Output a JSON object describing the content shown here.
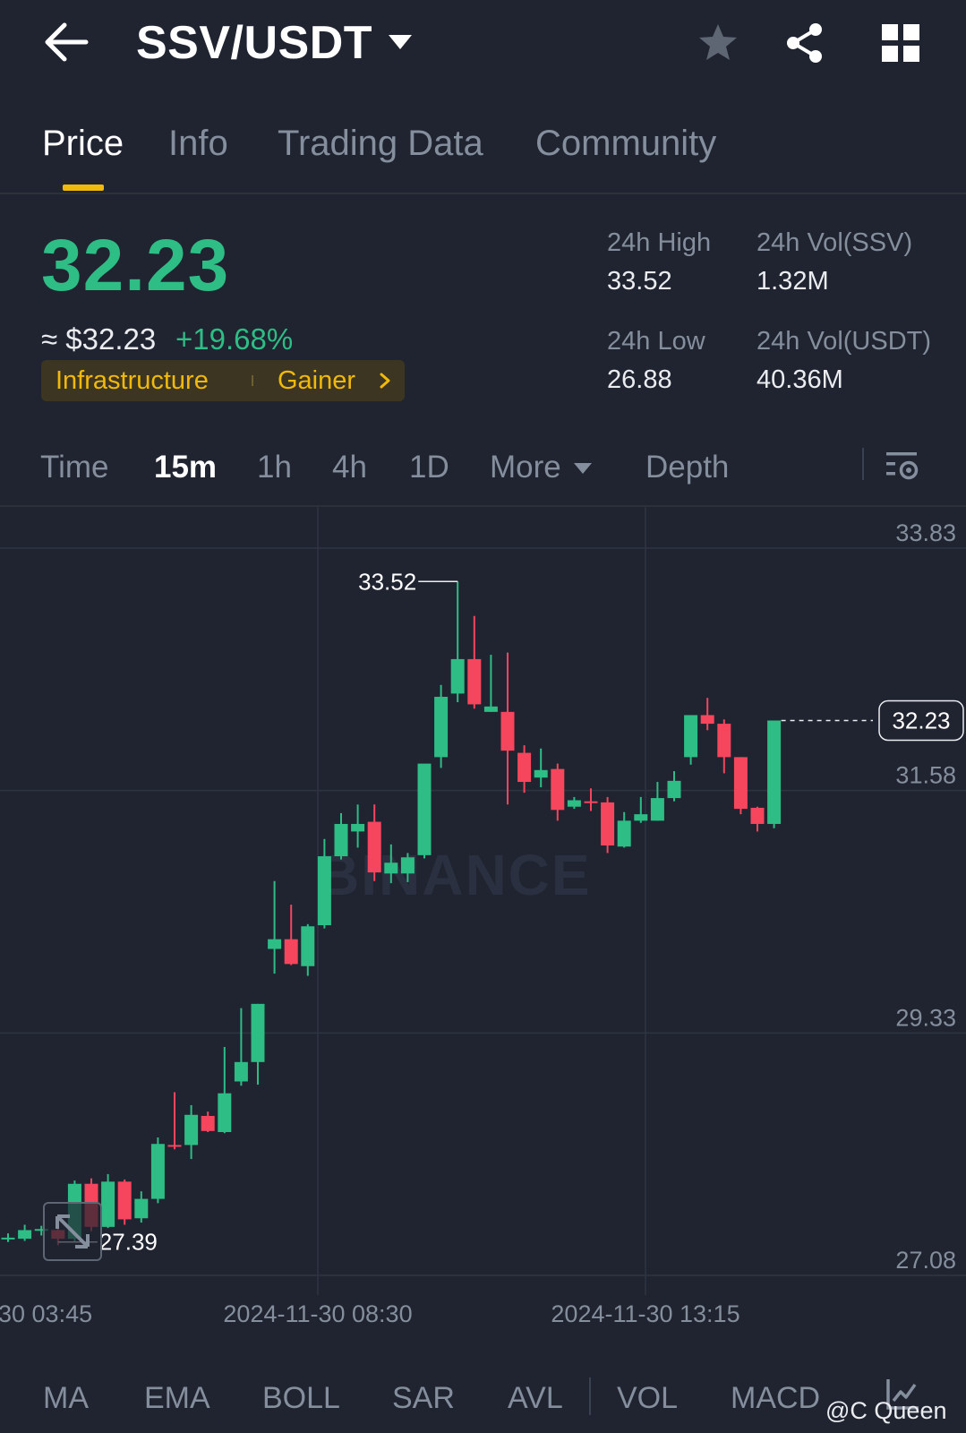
{
  "header": {
    "pair": "SSV/USDT",
    "icons": [
      "back-arrow-icon",
      "caret-down-icon",
      "star-icon",
      "share-icon",
      "grid-icon"
    ]
  },
  "tabs": [
    {
      "label": "Price",
      "active": true
    },
    {
      "label": "Info",
      "active": false
    },
    {
      "label": "Trading Data",
      "active": false
    },
    {
      "label": "Community",
      "active": false
    }
  ],
  "price": {
    "last": "32.23",
    "usd": "≈ $32.23",
    "change": "+19.68%",
    "tag_category": "Infrastructure",
    "tag_rank": "Gainer"
  },
  "stats": {
    "high_label": "24h High",
    "high_value": "33.52",
    "low_label": "24h Low",
    "low_value": "26.88",
    "vol_base_label": "24h Vol(SSV)",
    "vol_base_value": "1.32M",
    "vol_quote_label": "24h Vol(USDT)",
    "vol_quote_value": "40.36M"
  },
  "intervals": [
    {
      "label": "Time",
      "active": false
    },
    {
      "label": "15m",
      "active": true
    },
    {
      "label": "1h",
      "active": false
    },
    {
      "label": "4h",
      "active": false
    },
    {
      "label": "1D",
      "active": false
    },
    {
      "label": "More",
      "active": false
    },
    {
      "label": "Depth",
      "active": false
    }
  ],
  "colors": {
    "up": "#2ebd85",
    "down": "#f6465d",
    "accent": "#f0b90b",
    "background": "#1f2430"
  },
  "chart": {
    "watermark": "BINANCE",
    "price_axis": [
      "33.83",
      "31.58",
      "29.33",
      "27.08"
    ],
    "time_axis": [
      "30 03:45",
      "2024-11-30 08:30",
      "2024-11-30 13:15"
    ],
    "high_marker": "33.52",
    "low_marker": "27.39",
    "last_price_label": "32.23"
  },
  "chart_data": {
    "type": "candlestick",
    "interval": "15m",
    "y_ticks": [
      33.83,
      31.58,
      29.33,
      27.08
    ],
    "x_ticks": [
      "30 03:45",
      "2024-11-30 08:30",
      "2024-11-30 13:15"
    ],
    "ylim": [
      27.08,
      33.83
    ],
    "high": 33.52,
    "low": 27.39,
    "last": 32.23,
    "candles": [
      {
        "o": 27.43,
        "h": 27.47,
        "l": 27.39,
        "c": 27.43
      },
      {
        "o": 27.42,
        "h": 27.55,
        "l": 27.4,
        "c": 27.5
      },
      {
        "o": 27.5,
        "h": 27.54,
        "l": 27.45,
        "c": 27.51
      },
      {
        "o": 27.5,
        "h": 27.54,
        "l": 27.36,
        "c": 27.42
      },
      {
        "o": 27.42,
        "h": 27.96,
        "l": 27.39,
        "c": 27.93
      },
      {
        "o": 27.93,
        "h": 27.98,
        "l": 27.49,
        "c": 27.53
      },
      {
        "o": 27.53,
        "h": 28.02,
        "l": 27.52,
        "c": 27.95
      },
      {
        "o": 27.95,
        "h": 27.97,
        "l": 27.55,
        "c": 27.6
      },
      {
        "o": 27.61,
        "h": 27.86,
        "l": 27.57,
        "c": 27.79
      },
      {
        "o": 27.79,
        "h": 28.36,
        "l": 27.75,
        "c": 28.3
      },
      {
        "o": 28.29,
        "h": 28.78,
        "l": 28.25,
        "c": 28.28
      },
      {
        "o": 28.29,
        "h": 28.66,
        "l": 28.16,
        "c": 28.57
      },
      {
        "o": 28.56,
        "h": 28.6,
        "l": 28.41,
        "c": 28.42
      },
      {
        "o": 28.41,
        "h": 29.2,
        "l": 28.4,
        "c": 28.77
      },
      {
        "o": 28.88,
        "h": 29.56,
        "l": 28.84,
        "c": 29.06
      },
      {
        "o": 29.06,
        "h": 29.6,
        "l": 28.85,
        "c": 29.6
      },
      {
        "o": 30.11,
        "h": 30.74,
        "l": 29.88,
        "c": 30.2
      },
      {
        "o": 30.2,
        "h": 30.52,
        "l": 29.96,
        "c": 29.97
      },
      {
        "o": 29.95,
        "h": 30.34,
        "l": 29.86,
        "c": 30.32
      },
      {
        "o": 30.33,
        "h": 31.13,
        "l": 30.3,
        "c": 30.97
      },
      {
        "o": 30.97,
        "h": 31.37,
        "l": 30.94,
        "c": 31.27
      },
      {
        "o": 31.2,
        "h": 31.45,
        "l": 31.05,
        "c": 31.27
      },
      {
        "o": 31.29,
        "h": 31.45,
        "l": 30.74,
        "c": 30.82
      },
      {
        "o": 30.81,
        "h": 31.08,
        "l": 30.72,
        "c": 30.91
      },
      {
        "o": 30.81,
        "h": 31.0,
        "l": 30.73,
        "c": 30.96
      },
      {
        "o": 30.98,
        "h": 31.72,
        "l": 30.95,
        "c": 31.83
      },
      {
        "o": 31.89,
        "h": 32.56,
        "l": 31.79,
        "c": 32.45
      },
      {
        "o": 32.48,
        "h": 33.52,
        "l": 32.4,
        "c": 32.8
      },
      {
        "o": 32.8,
        "h": 33.2,
        "l": 32.34,
        "c": 32.38
      },
      {
        "o": 32.31,
        "h": 32.84,
        "l": 32.31,
        "c": 32.36
      },
      {
        "o": 32.31,
        "h": 32.86,
        "l": 31.45,
        "c": 31.95
      },
      {
        "o": 31.93,
        "h": 32.0,
        "l": 31.56,
        "c": 31.66
      },
      {
        "o": 31.7,
        "h": 31.97,
        "l": 31.61,
        "c": 31.77
      },
      {
        "o": 31.78,
        "h": 31.83,
        "l": 31.3,
        "c": 31.4
      },
      {
        "o": 31.43,
        "h": 31.52,
        "l": 31.41,
        "c": 31.49
      },
      {
        "o": 31.48,
        "h": 31.6,
        "l": 31.39,
        "c": 31.47
      },
      {
        "o": 31.47,
        "h": 31.52,
        "l": 31.0,
        "c": 31.07
      },
      {
        "o": 31.06,
        "h": 31.38,
        "l": 31.05,
        "c": 31.3
      },
      {
        "o": 31.3,
        "h": 31.52,
        "l": 31.28,
        "c": 31.36
      },
      {
        "o": 31.3,
        "h": 31.66,
        "l": 31.3,
        "c": 31.51
      },
      {
        "o": 31.51,
        "h": 31.76,
        "l": 31.48,
        "c": 31.67
      },
      {
        "o": 31.89,
        "h": 32.28,
        "l": 31.82,
        "c": 32.28
      },
      {
        "o": 32.28,
        "h": 32.44,
        "l": 32.14,
        "c": 32.2
      },
      {
        "o": 32.2,
        "h": 32.24,
        "l": 31.74,
        "c": 31.89
      },
      {
        "o": 31.89,
        "h": 31.89,
        "l": 31.36,
        "c": 31.41
      },
      {
        "o": 31.42,
        "h": 31.43,
        "l": 31.2,
        "c": 31.27
      },
      {
        "o": 31.27,
        "h": 32.23,
        "l": 31.23,
        "c": 32.23
      }
    ]
  },
  "indicators": [
    "MA",
    "EMA",
    "BOLL",
    "SAR",
    "AVL",
    "VOL",
    "MACD"
  ],
  "credit": "@C Queen"
}
